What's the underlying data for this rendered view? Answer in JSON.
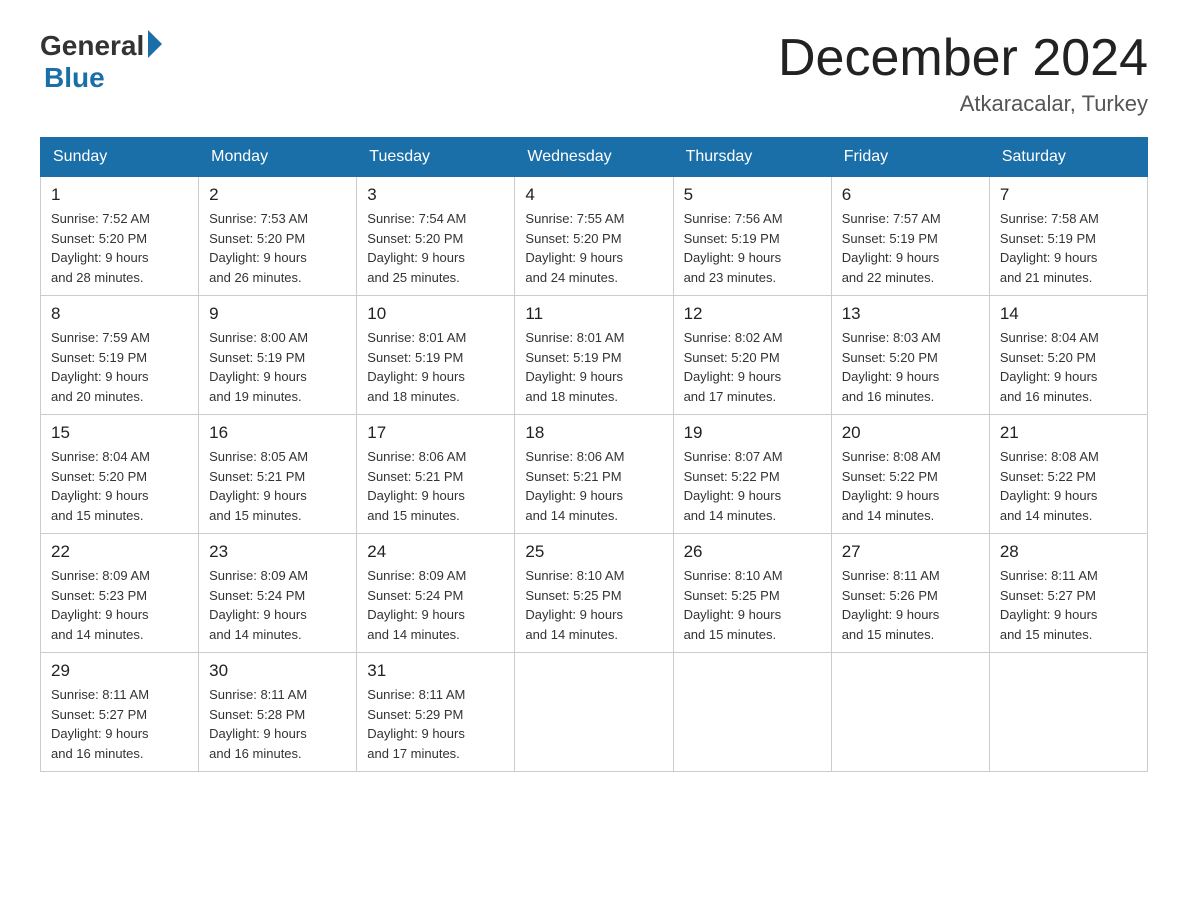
{
  "header": {
    "logo_general": "General",
    "logo_blue": "Blue",
    "month_title": "December 2024",
    "location": "Atkaracalar, Turkey"
  },
  "columns": [
    "Sunday",
    "Monday",
    "Tuesday",
    "Wednesday",
    "Thursday",
    "Friday",
    "Saturday"
  ],
  "weeks": [
    [
      {
        "day": "1",
        "sunrise": "7:52 AM",
        "sunset": "5:20 PM",
        "daylight": "9 hours and 28 minutes."
      },
      {
        "day": "2",
        "sunrise": "7:53 AM",
        "sunset": "5:20 PM",
        "daylight": "9 hours and 26 minutes."
      },
      {
        "day": "3",
        "sunrise": "7:54 AM",
        "sunset": "5:20 PM",
        "daylight": "9 hours and 25 minutes."
      },
      {
        "day": "4",
        "sunrise": "7:55 AM",
        "sunset": "5:20 PM",
        "daylight": "9 hours and 24 minutes."
      },
      {
        "day": "5",
        "sunrise": "7:56 AM",
        "sunset": "5:19 PM",
        "daylight": "9 hours and 23 minutes."
      },
      {
        "day": "6",
        "sunrise": "7:57 AM",
        "sunset": "5:19 PM",
        "daylight": "9 hours and 22 minutes."
      },
      {
        "day": "7",
        "sunrise": "7:58 AM",
        "sunset": "5:19 PM",
        "daylight": "9 hours and 21 minutes."
      }
    ],
    [
      {
        "day": "8",
        "sunrise": "7:59 AM",
        "sunset": "5:19 PM",
        "daylight": "9 hours and 20 minutes."
      },
      {
        "day": "9",
        "sunrise": "8:00 AM",
        "sunset": "5:19 PM",
        "daylight": "9 hours and 19 minutes."
      },
      {
        "day": "10",
        "sunrise": "8:01 AM",
        "sunset": "5:19 PM",
        "daylight": "9 hours and 18 minutes."
      },
      {
        "day": "11",
        "sunrise": "8:01 AM",
        "sunset": "5:19 PM",
        "daylight": "9 hours and 18 minutes."
      },
      {
        "day": "12",
        "sunrise": "8:02 AM",
        "sunset": "5:20 PM",
        "daylight": "9 hours and 17 minutes."
      },
      {
        "day": "13",
        "sunrise": "8:03 AM",
        "sunset": "5:20 PM",
        "daylight": "9 hours and 16 minutes."
      },
      {
        "day": "14",
        "sunrise": "8:04 AM",
        "sunset": "5:20 PM",
        "daylight": "9 hours and 16 minutes."
      }
    ],
    [
      {
        "day": "15",
        "sunrise": "8:04 AM",
        "sunset": "5:20 PM",
        "daylight": "9 hours and 15 minutes."
      },
      {
        "day": "16",
        "sunrise": "8:05 AM",
        "sunset": "5:21 PM",
        "daylight": "9 hours and 15 minutes."
      },
      {
        "day": "17",
        "sunrise": "8:06 AM",
        "sunset": "5:21 PM",
        "daylight": "9 hours and 15 minutes."
      },
      {
        "day": "18",
        "sunrise": "8:06 AM",
        "sunset": "5:21 PM",
        "daylight": "9 hours and 14 minutes."
      },
      {
        "day": "19",
        "sunrise": "8:07 AM",
        "sunset": "5:22 PM",
        "daylight": "9 hours and 14 minutes."
      },
      {
        "day": "20",
        "sunrise": "8:08 AM",
        "sunset": "5:22 PM",
        "daylight": "9 hours and 14 minutes."
      },
      {
        "day": "21",
        "sunrise": "8:08 AM",
        "sunset": "5:22 PM",
        "daylight": "9 hours and 14 minutes."
      }
    ],
    [
      {
        "day": "22",
        "sunrise": "8:09 AM",
        "sunset": "5:23 PM",
        "daylight": "9 hours and 14 minutes."
      },
      {
        "day": "23",
        "sunrise": "8:09 AM",
        "sunset": "5:24 PM",
        "daylight": "9 hours and 14 minutes."
      },
      {
        "day": "24",
        "sunrise": "8:09 AM",
        "sunset": "5:24 PM",
        "daylight": "9 hours and 14 minutes."
      },
      {
        "day": "25",
        "sunrise": "8:10 AM",
        "sunset": "5:25 PM",
        "daylight": "9 hours and 14 minutes."
      },
      {
        "day": "26",
        "sunrise": "8:10 AM",
        "sunset": "5:25 PM",
        "daylight": "9 hours and 15 minutes."
      },
      {
        "day": "27",
        "sunrise": "8:11 AM",
        "sunset": "5:26 PM",
        "daylight": "9 hours and 15 minutes."
      },
      {
        "day": "28",
        "sunrise": "8:11 AM",
        "sunset": "5:27 PM",
        "daylight": "9 hours and 15 minutes."
      }
    ],
    [
      {
        "day": "29",
        "sunrise": "8:11 AM",
        "sunset": "5:27 PM",
        "daylight": "9 hours and 16 minutes."
      },
      {
        "day": "30",
        "sunrise": "8:11 AM",
        "sunset": "5:28 PM",
        "daylight": "9 hours and 16 minutes."
      },
      {
        "day": "31",
        "sunrise": "8:11 AM",
        "sunset": "5:29 PM",
        "daylight": "9 hours and 17 minutes."
      },
      null,
      null,
      null,
      null
    ]
  ]
}
